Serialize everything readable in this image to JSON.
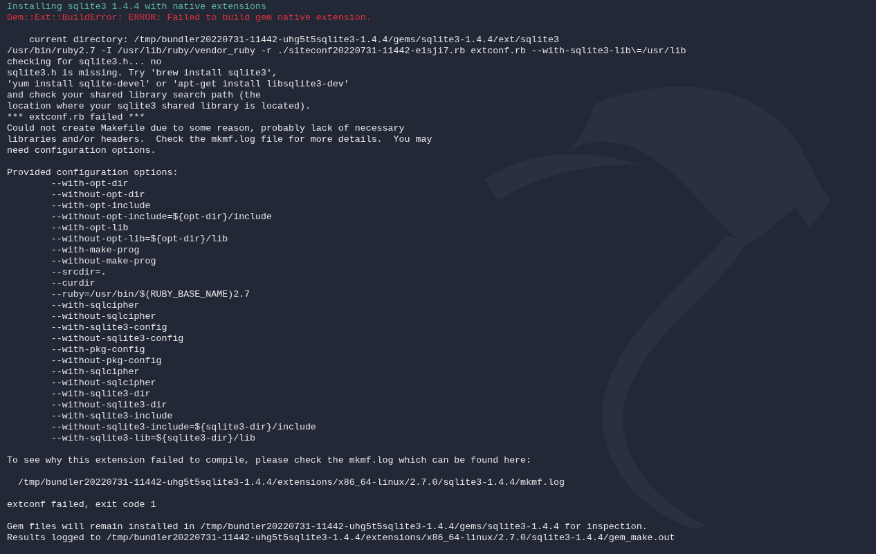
{
  "terminal": {
    "lines": [
      {
        "kind": "info",
        "text": "Installing sqlite3 1.4.4 with native extensions"
      },
      {
        "kind": "error",
        "text": "Gem::Ext::BuildError: ERROR: Failed to build gem native extension."
      },
      {
        "kind": "blank"
      },
      {
        "kind": "output",
        "text": "    current directory: /tmp/bundler20220731-11442-uhg5t5sqlite3-1.4.4/gems/sqlite3-1.4.4/ext/sqlite3"
      },
      {
        "kind": "output",
        "text": "/usr/bin/ruby2.7 -I /usr/lib/ruby/vendor_ruby -r ./siteconf20220731-11442-e1sji7.rb extconf.rb --with-sqlite3-lib\\=/usr/lib"
      },
      {
        "kind": "output",
        "text": "checking for sqlite3.h... no"
      },
      {
        "kind": "output",
        "text": "sqlite3.h is missing. Try 'brew install sqlite3',"
      },
      {
        "kind": "output",
        "text": "'yum install sqlite-devel' or 'apt-get install libsqlite3-dev'"
      },
      {
        "kind": "output",
        "text": "and check your shared library search path (the"
      },
      {
        "kind": "output",
        "text": "location where your sqlite3 shared library is located)."
      },
      {
        "kind": "output",
        "text": "*** extconf.rb failed ***"
      },
      {
        "kind": "output",
        "text": "Could not create Makefile due to some reason, probably lack of necessary"
      },
      {
        "kind": "output",
        "text": "libraries and/or headers.  Check the mkmf.log file for more details.  You may"
      },
      {
        "kind": "output",
        "text": "need configuration options."
      },
      {
        "kind": "blank"
      },
      {
        "kind": "output",
        "text": "Provided configuration options:"
      },
      {
        "kind": "output",
        "text": "        --with-opt-dir"
      },
      {
        "kind": "output",
        "text": "        --without-opt-dir"
      },
      {
        "kind": "output",
        "text": "        --with-opt-include"
      },
      {
        "kind": "output",
        "text": "        --without-opt-include=${opt-dir}/include"
      },
      {
        "kind": "output",
        "text": "        --with-opt-lib"
      },
      {
        "kind": "output",
        "text": "        --without-opt-lib=${opt-dir}/lib"
      },
      {
        "kind": "output",
        "text": "        --with-make-prog"
      },
      {
        "kind": "output",
        "text": "        --without-make-prog"
      },
      {
        "kind": "output",
        "text": "        --srcdir=."
      },
      {
        "kind": "output",
        "text": "        --curdir"
      },
      {
        "kind": "output",
        "text": "        --ruby=/usr/bin/$(RUBY_BASE_NAME)2.7"
      },
      {
        "kind": "output",
        "text": "        --with-sqlcipher"
      },
      {
        "kind": "output",
        "text": "        --without-sqlcipher"
      },
      {
        "kind": "output",
        "text": "        --with-sqlite3-config"
      },
      {
        "kind": "output",
        "text": "        --without-sqlite3-config"
      },
      {
        "kind": "output",
        "text": "        --with-pkg-config"
      },
      {
        "kind": "output",
        "text": "        --without-pkg-config"
      },
      {
        "kind": "output",
        "text": "        --with-sqlcipher"
      },
      {
        "kind": "output",
        "text": "        --without-sqlcipher"
      },
      {
        "kind": "output",
        "text": "        --with-sqlite3-dir"
      },
      {
        "kind": "output",
        "text": "        --without-sqlite3-dir"
      },
      {
        "kind": "output",
        "text": "        --with-sqlite3-include"
      },
      {
        "kind": "output",
        "text": "        --without-sqlite3-include=${sqlite3-dir}/include"
      },
      {
        "kind": "output",
        "text": "        --with-sqlite3-lib=${sqlite3-dir}/lib"
      },
      {
        "kind": "blank"
      },
      {
        "kind": "output",
        "text": "To see why this extension failed to compile, please check the mkmf.log which can be found here:"
      },
      {
        "kind": "blank"
      },
      {
        "kind": "output",
        "text": "  /tmp/bundler20220731-11442-uhg5t5sqlite3-1.4.4/extensions/x86_64-linux/2.7.0/sqlite3-1.4.4/mkmf.log"
      },
      {
        "kind": "blank"
      },
      {
        "kind": "output",
        "text": "extconf failed, exit code 1"
      },
      {
        "kind": "blank"
      },
      {
        "kind": "output",
        "text": "Gem files will remain installed in /tmp/bundler20220731-11442-uhg5t5sqlite3-1.4.4/gems/sqlite3-1.4.4 for inspection."
      },
      {
        "kind": "output",
        "text": "Results logged to /tmp/bundler20220731-11442-uhg5t5sqlite3-1.4.4/extensions/x86_64-linux/2.7.0/sqlite3-1.4.4/gem_make.out"
      }
    ]
  }
}
